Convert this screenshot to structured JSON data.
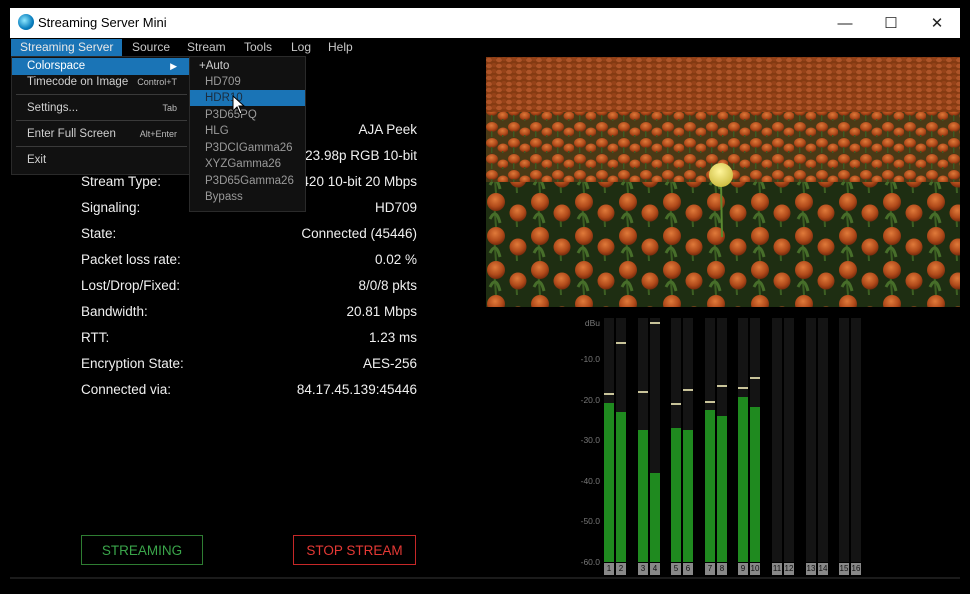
{
  "window": {
    "title": "Streaming Server Mini",
    "controls": [
      "—",
      "☐",
      "✕"
    ]
  },
  "menubar": [
    "Streaming Server",
    "Source",
    "Stream",
    "Tools",
    "Log",
    "Help"
  ],
  "menu_main": {
    "colorspace": "Colorspace",
    "timecode": "Timecode on Image",
    "timecode_shortcut": "Control+T",
    "settings": "Settings...",
    "settings_shortcut": "Tab",
    "fullscreen": "Enter Full Screen",
    "fullscreen_shortcut": "Alt+Enter",
    "exit": "Exit"
  },
  "colorspace_menu": [
    "+Auto",
    "HD709",
    "HDR10",
    "P3D65PQ",
    "HLG",
    "P3DCIGamma26",
    "XYZGamma26",
    "P3D65Gamma26",
    "Bypass"
  ],
  "info": {
    "device_value": "AJA Peek",
    "video_value": "D 23.98p RGB 10-bit",
    "stream_type_label": "Stream Type:",
    "stream_type_value": "420 10-bit 20 Mbps",
    "signaling_label": "Signaling:",
    "signaling_value": "HD709",
    "state_label": "State:",
    "state_value": "Connected (45446)",
    "packet_loss_label": "Packet loss rate:",
    "packet_loss_value": "0.02 %",
    "lost_label": "Lost/Drop/Fixed:",
    "lost_value": "8/0/8 pkts",
    "bandwidth_label": "Bandwidth:",
    "bandwidth_value": "20.81 Mbps",
    "rtt_label": "RTT:",
    "rtt_value": "1.23 ms",
    "encryption_label": "Encryption State:",
    "encryption_value": "AES-256",
    "connected_label": "Connected via:",
    "connected_value": "84.17.45.139:45446"
  },
  "buttons": {
    "streaming": "STREAMING",
    "stop": "STOP STREAM"
  },
  "meters": {
    "unit": "dBu",
    "scale_labels": [
      "-10.0",
      "-20.0",
      "-30.0",
      "-40.0",
      "-50.0",
      "-60.0"
    ],
    "db_range": [
      -60,
      0
    ],
    "active_color": "#1f8a1f",
    "peak_color": "#c9c49a",
    "channels": [
      {
        "id": "1",
        "level_db": -21,
        "peak_db": -18.5
      },
      {
        "id": "2",
        "level_db": -23,
        "peak_db": -6
      },
      {
        "id": "3",
        "level_db": -27.5,
        "peak_db": -18
      },
      {
        "id": "4",
        "level_db": -38,
        "peak_db": -1
      },
      {
        "id": "5",
        "level_db": -27,
        "peak_db": -21
      },
      {
        "id": "6",
        "level_db": -27.5,
        "peak_db": -17.5
      },
      {
        "id": "7",
        "level_db": -22.5,
        "peak_db": -20.5
      },
      {
        "id": "8",
        "level_db": -24,
        "peak_db": -16.5
      },
      {
        "id": "9",
        "level_db": -19.5,
        "peak_db": -17
      },
      {
        "id": "10",
        "level_db": -22,
        "peak_db": -14.5
      },
      {
        "id": "11",
        "level_db": null,
        "peak_db": null
      },
      {
        "id": "12",
        "level_db": null,
        "peak_db": null
      },
      {
        "id": "13",
        "level_db": null,
        "peak_db": null
      },
      {
        "id": "14",
        "level_db": null,
        "peak_db": null
      },
      {
        "id": "15",
        "level_db": null,
        "peak_db": null
      },
      {
        "id": "16",
        "level_db": null,
        "peak_db": null
      }
    ]
  }
}
